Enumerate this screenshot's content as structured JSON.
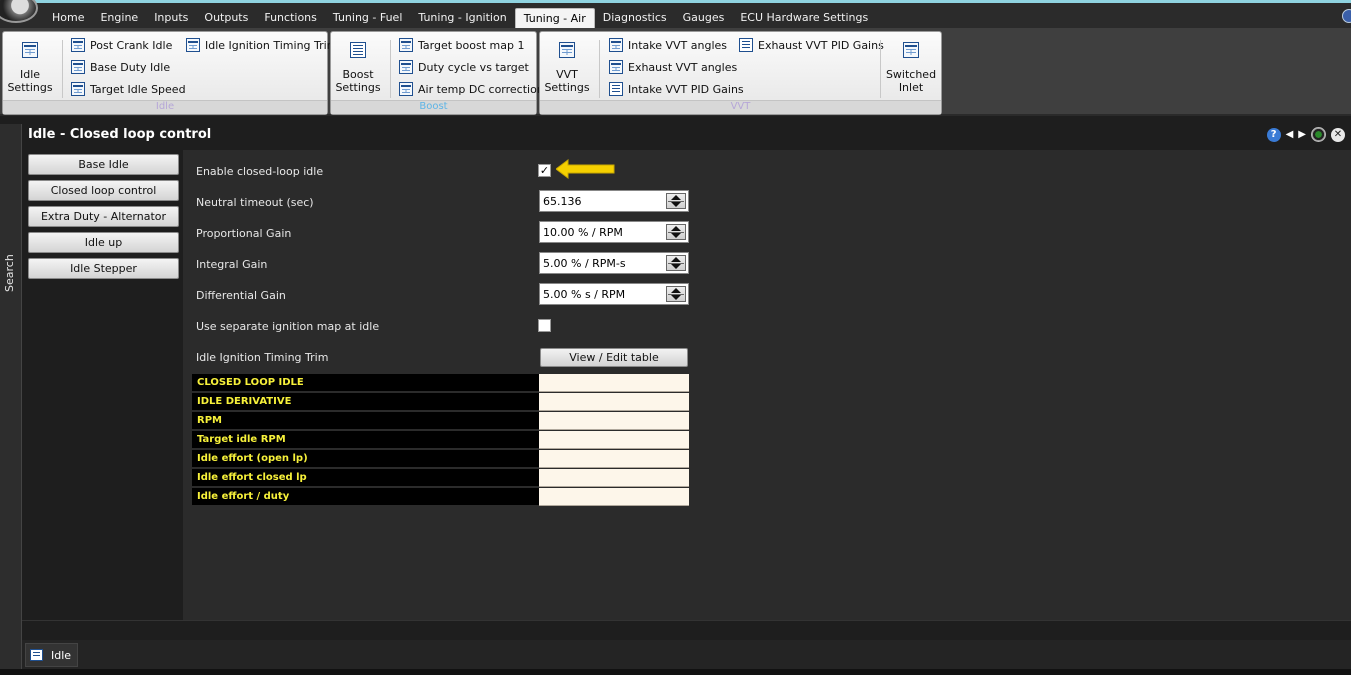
{
  "menu": {
    "items": [
      "Home",
      "Engine",
      "Inputs",
      "Outputs",
      "Functions",
      "Tuning - Fuel",
      "Tuning - Ignition",
      "Tuning - Air",
      "Diagnostics",
      "Gauges",
      "ECU Hardware Settings"
    ],
    "active": "Tuning - Air"
  },
  "ribbon": {
    "idle": {
      "caption": "Idle",
      "settings_line1": "Idle",
      "settings_line2": "Settings",
      "post_crank_idle": "Post Crank Idle",
      "base_duty_idle": "Base Duty Idle",
      "target_idle_speed": "Target Idle Speed",
      "idle_ignition_timing_trim": "Idle Ignition Timing Trim"
    },
    "boost": {
      "caption": "Boost",
      "settings_line1": "Boost",
      "settings_line2": "Settings",
      "target_boost_map": "Target boost map 1",
      "duty_cycle_vs_target": "Duty cycle vs target",
      "air_temp_dc_correction": "Air temp DC correction"
    },
    "vvt": {
      "caption": "VVT",
      "settings_line1": "VVT",
      "settings_line2": "Settings",
      "intake_vvt_angles": "Intake VVT angles",
      "exhaust_vvt_angles": "Exhaust VVT angles",
      "intake_vvt_pid_gains": "Intake VVT PID Gains",
      "exhaust_vvt_pid_gains": "Exhaust VVT PID Gains",
      "switched_inlet_line1": "Switched",
      "switched_inlet_line2": "Inlet"
    }
  },
  "sidebar": {
    "search_label": "Search"
  },
  "panel": {
    "title": "Idle - Closed loop control",
    "help_glyph": "?",
    "nav": [
      "Base Idle",
      "Closed loop control",
      "Extra Duty - Alternator",
      "Idle up",
      "Idle Stepper"
    ]
  },
  "form": {
    "enable_closed_loop_label": "Enable closed-loop idle",
    "enable_closed_loop_checked": true,
    "check_glyph": "✓",
    "neutral_timeout_label": "Neutral timeout (sec)",
    "neutral_timeout_value": "65.136",
    "proportional_gain_label": "Proportional Gain",
    "proportional_gain_value": "10.00 % / RPM",
    "integral_gain_label": "Integral Gain",
    "integral_gain_value": "5.00 % / RPM-s",
    "differential_gain_label": "Differential Gain",
    "differential_gain_value": "5.00 % s / RPM",
    "separate_ign_map_label": "Use separate ignition map at idle",
    "separate_ign_map_checked": false,
    "idle_ign_trim_label": "Idle Ignition Timing Trim",
    "view_edit_label": "View / Edit table"
  },
  "gauges": [
    {
      "label": "CLOSED LOOP IDLE",
      "value": ""
    },
    {
      "label": "IDLE DERIVATIVE",
      "value": ""
    },
    {
      "label": "RPM",
      "value": ""
    },
    {
      "label": "Target idle RPM",
      "value": ""
    },
    {
      "label": "Idle effort (open lp)",
      "value": ""
    },
    {
      "label": "Idle effort closed lp",
      "value": ""
    },
    {
      "label": "Idle effort / duty",
      "value": ""
    }
  ],
  "tabs": {
    "idle_tab": "Idle"
  },
  "colors": {
    "accent_yellow": "#f7f13a",
    "arrow": "#f5d000",
    "boost_caption": "#5db4e6",
    "idle_caption": "#b6a7d8"
  }
}
